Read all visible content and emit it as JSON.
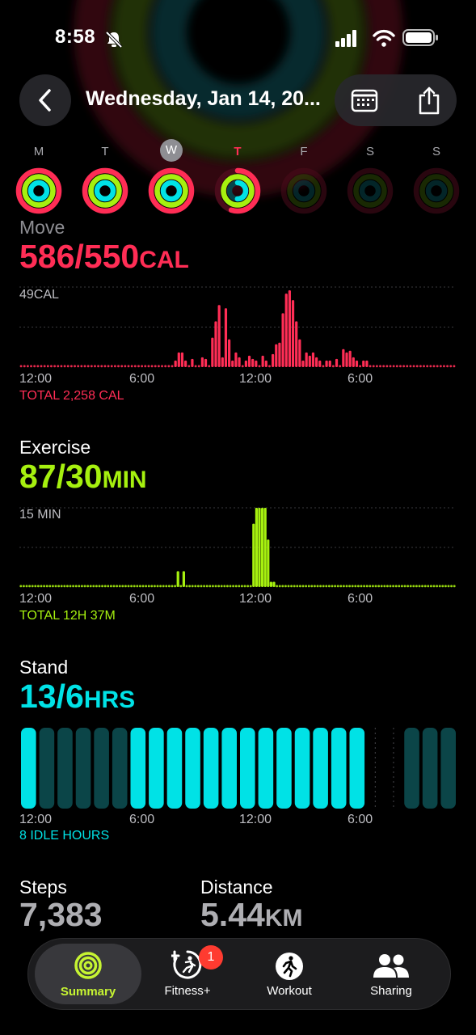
{
  "status": {
    "time": "8:58"
  },
  "header": {
    "title": "Wednesday, Jan 14, 20..."
  },
  "week": {
    "days": [
      {
        "letter": "M",
        "move": 1.0,
        "exercise": 1.0,
        "stand": 1.0,
        "state": "past"
      },
      {
        "letter": "T",
        "move": 1.0,
        "exercise": 1.0,
        "stand": 1.0,
        "state": "past"
      },
      {
        "letter": "W",
        "move": 1.0,
        "exercise": 1.0,
        "stand": 1.0,
        "state": "selected"
      },
      {
        "letter": "T",
        "move": 0.55,
        "exercise": 1.0,
        "stand": 0.5,
        "state": "today"
      },
      {
        "letter": "F",
        "move": 0,
        "exercise": 0,
        "stand": 0,
        "state": "future"
      },
      {
        "letter": "S",
        "move": 0,
        "exercise": 0,
        "stand": 0,
        "state": "future"
      },
      {
        "letter": "S",
        "move": 0,
        "exercise": 0,
        "stand": 0,
        "state": "future"
      }
    ]
  },
  "move": {
    "title": "Move",
    "value": "586/550",
    "unit": "CAL",
    "max_label": "49CAL",
    "axis": [
      "12:00",
      "6:00",
      "12:00",
      "6:00"
    ],
    "total": "TOTAL 2,258 CAL",
    "color": "#ff2d55"
  },
  "exercise": {
    "title": "Exercise",
    "value": "87/30",
    "unit": "MIN",
    "max_label": "15 MIN",
    "axis": [
      "12:00",
      "6:00",
      "12:00",
      "6:00"
    ],
    "total": "TOTAL 12H 37M",
    "color": "#a6f00f"
  },
  "stand": {
    "title": "Stand",
    "value": "13/6",
    "unit": "HRS",
    "axis": [
      "12:00",
      "6:00",
      "12:00",
      "6:00"
    ],
    "total": "8 IDLE HOURS",
    "color": "#00e2e6"
  },
  "stats": {
    "steps_title": "Steps",
    "steps_value": "7,383",
    "distance_title": "Distance",
    "distance_value": "5.44",
    "distance_unit": "KM"
  },
  "tabbar": {
    "summary": "Summary",
    "fitness": "Fitness+",
    "fitness_badge": "1",
    "workout": "Workout",
    "sharing": "Sharing"
  },
  "chart_data": [
    {
      "type": "bar",
      "title": "Move",
      "ylabel": "CAL",
      "xlabels": [
        "12:00",
        "6:00",
        "12:00",
        "6:00"
      ],
      "ylim": [
        0,
        49
      ],
      "values": [
        0,
        0,
        0,
        0,
        0,
        0,
        0,
        0,
        0,
        0,
        0,
        0,
        0,
        0,
        0,
        0,
        0,
        0,
        0,
        0,
        0,
        0,
        0,
        0,
        0,
        0,
        0,
        0,
        0,
        0,
        0,
        0,
        0,
        0,
        0,
        0,
        0,
        0,
        0,
        0,
        0,
        0,
        0,
        0,
        0,
        0,
        4,
        9,
        9,
        4,
        0,
        5,
        0,
        0,
        6,
        5,
        0,
        18,
        28,
        38,
        6,
        36,
        17,
        4,
        9,
        6,
        0,
        4,
        7,
        5,
        4,
        0,
        7,
        4,
        0,
        8,
        14,
        15,
        33,
        45,
        47,
        41,
        28,
        17,
        4,
        9,
        7,
        9,
        6,
        4,
        0,
        4,
        4,
        0,
        5,
        0,
        11,
        9,
        10,
        6,
        4,
        0,
        4,
        4,
        0,
        0,
        0,
        0,
        0,
        0,
        0,
        0,
        0,
        0,
        0,
        0,
        0,
        0,
        0,
        0,
        0,
        0,
        0,
        0,
        0,
        0,
        0,
        0,
        0,
        0
      ]
    },
    {
      "type": "bar",
      "title": "Exercise",
      "ylabel": "MIN",
      "xlabels": [
        "12:00",
        "6:00",
        "12:00",
        "6:00"
      ],
      "ylim": [
        0,
        15
      ],
      "values": [
        0,
        0,
        0,
        0,
        0,
        0,
        0,
        0,
        0,
        0,
        0,
        0,
        0,
        0,
        0,
        0,
        0,
        0,
        0,
        0,
        0,
        0,
        0,
        0,
        0,
        0,
        0,
        0,
        0,
        0,
        0,
        0,
        0,
        0,
        0,
        0,
        0,
        0,
        0,
        0,
        0,
        0,
        0,
        0,
        0,
        0,
        0,
        0,
        0,
        0,
        0,
        0,
        0,
        0,
        3,
        0,
        3,
        0,
        0,
        0,
        0,
        0,
        0,
        0,
        0,
        0,
        0,
        0,
        0,
        0,
        0,
        0,
        0,
        0,
        0,
        0,
        0,
        0,
        0,
        0,
        12,
        15,
        15,
        15,
        15,
        9,
        1,
        1,
        0,
        0,
        0,
        0,
        0,
        0,
        0,
        0,
        0,
        0,
        0,
        0,
        0,
        0,
        0,
        0,
        0,
        0,
        0,
        0,
        0,
        0,
        0,
        0,
        0,
        0,
        0,
        0,
        0,
        0,
        0,
        0,
        0,
        0,
        0,
        0,
        0,
        0,
        0,
        0,
        0,
        0,
        0,
        0,
        0,
        0,
        0,
        0,
        0,
        0,
        0,
        0,
        0,
        0,
        0,
        0,
        0,
        0,
        0,
        0,
        0,
        0
      ]
    },
    {
      "type": "bar",
      "title": "Stand",
      "ylabel": "HRS",
      "xlabels": [
        "12:00",
        "6:00",
        "12:00",
        "6:00"
      ],
      "hours": [
        1,
        0,
        0,
        0,
        0,
        0,
        1,
        1,
        1,
        1,
        1,
        1,
        1,
        1,
        1,
        1,
        1,
        1,
        1,
        -1,
        -1,
        0,
        0,
        0
      ]
    }
  ]
}
